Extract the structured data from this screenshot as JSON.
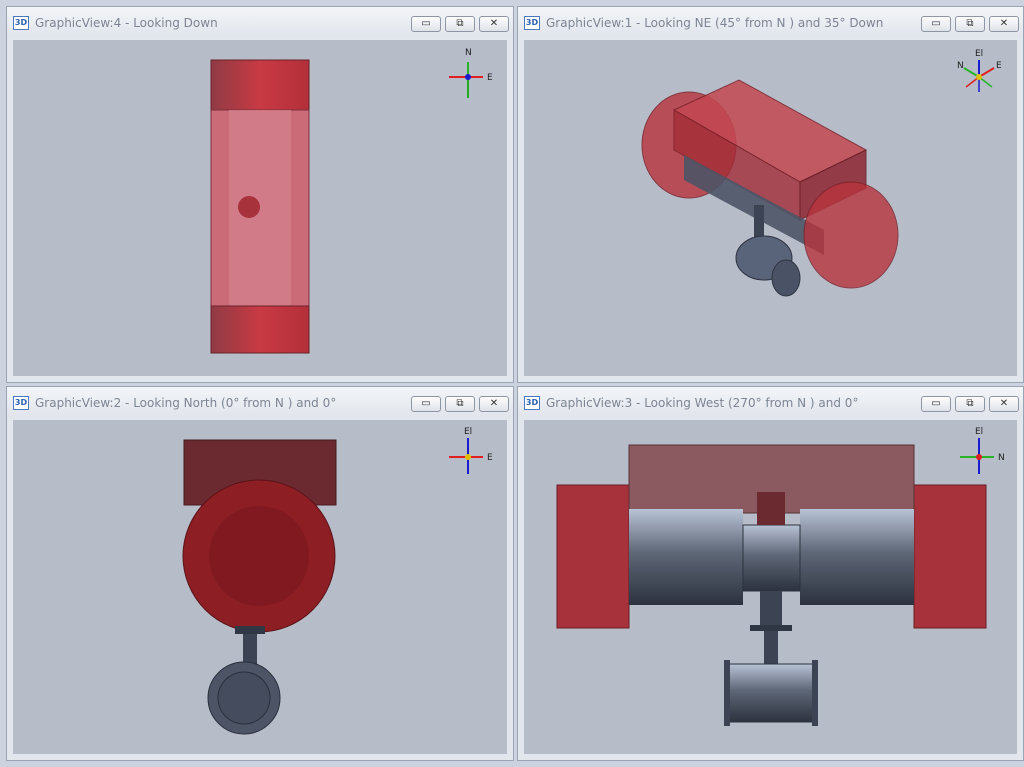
{
  "panes": [
    {
      "title": "GraphicView:4 - Looking Down",
      "icon_label": "3D"
    },
    {
      "title": "GraphicView:1 - Looking NE (45° from N ) and 35° Down",
      "icon_label": "3D"
    },
    {
      "title": "GraphicView:2 - Looking North (0° from N ) and 0°",
      "icon_label": "3D"
    },
    {
      "title": "GraphicView:3 - Looking West (270° from N ) and 0°",
      "icon_label": "3D"
    }
  ],
  "window_buttons": {
    "minimize": "▭",
    "restore": "⧉",
    "close": "✕"
  },
  "axes": {
    "view4": {
      "up": "N",
      "right": "E",
      "center": "El"
    },
    "view1": {
      "up": "El",
      "left": "N",
      "right": "E"
    },
    "view2": {
      "up": "El",
      "right": "E"
    },
    "view3": {
      "up": "El",
      "right": "N"
    }
  },
  "colors": {
    "viewport_bg": "#b6bdc9",
    "pane_chrome": "#e2e6ed",
    "title_text": "#7d8594",
    "body_red": "#b42a33",
    "pipe_steel": "#4a5363",
    "axis_green": "#27b427",
    "axis_red": "#e02020",
    "axis_blue": "#1a1ad0"
  }
}
